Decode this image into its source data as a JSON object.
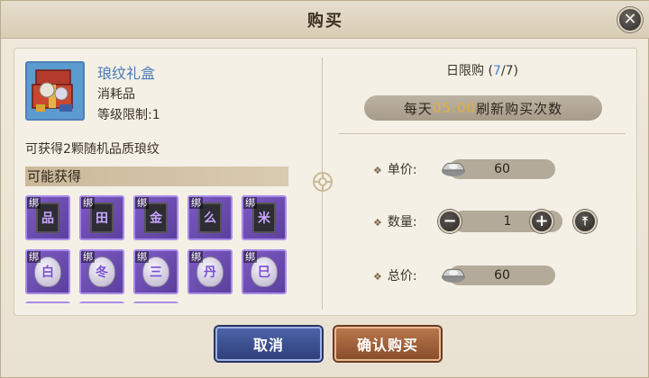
{
  "dialog": {
    "title": "购买",
    "close_icon": "close-x-icon"
  },
  "item": {
    "icon": "gift-box-icon",
    "name": "琅纹礼盒",
    "type": "消耗品",
    "level_limit": "等级限制:1",
    "description": "可获得2颗随机品质琅纹"
  },
  "drops": {
    "header": "可能获得",
    "bind_label": "绑",
    "row1": [
      {
        "glyph": "品"
      },
      {
        "glyph": "田"
      },
      {
        "glyph": "金"
      },
      {
        "glyph": "么"
      },
      {
        "glyph": "米"
      }
    ],
    "row2": [
      {
        "glyph": "白"
      },
      {
        "glyph": "冬"
      },
      {
        "glyph": "三"
      },
      {
        "glyph": "丹"
      },
      {
        "glyph": "巳"
      }
    ]
  },
  "purchase": {
    "limit_label_prefix": "日限购",
    "limit_open": " (",
    "limit_used": "7",
    "limit_sep": "/",
    "limit_total": "7",
    "limit_close": ")",
    "refresh_prefix": "每天",
    "refresh_time": "05:00",
    "refresh_suffix": "刷新购买次数",
    "unit_price_label": "单价:",
    "unit_price": "60",
    "quantity_label": "数量:",
    "quantity": "1",
    "total_price_label": "总价:",
    "total_price": "60",
    "currency_icon": "silver-ingot-icon",
    "minus_icon": "minus-icon",
    "plus_icon": "plus-icon",
    "max_icon": "max-arrow-icon"
  },
  "buttons": {
    "cancel": "取消",
    "confirm": "确认购买"
  },
  "colors": {
    "limit_number": "#3f86d6",
    "refresh_time": "#e0b040",
    "item_name": "#4a79b6",
    "cancel_button": "#3a4e91",
    "confirm_button": "#a0613b"
  }
}
